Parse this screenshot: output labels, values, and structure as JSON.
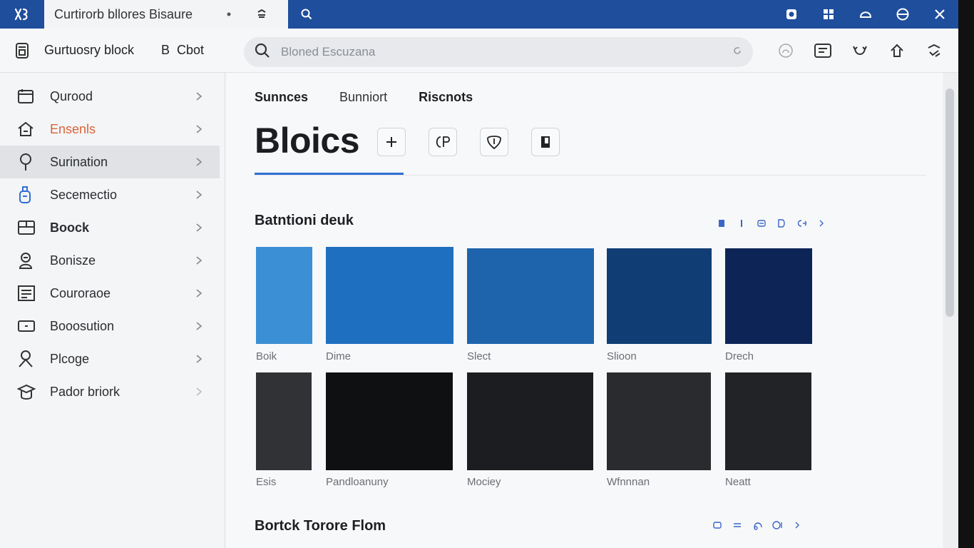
{
  "titlebar": {
    "logo_icon": "app-logo-icon",
    "tab_title": "Curtirorb bllores Bisaure",
    "tab_controls": [
      "dot-icon",
      "restore-icon"
    ],
    "search_icon": "search-icon",
    "window_controls": [
      "record-icon",
      "grid-icon",
      "minimize-icon",
      "globe-icon",
      "close-icon"
    ],
    "accent": "#1f4e9c"
  },
  "toolbar": {
    "app_icon": "printer-icon",
    "app_name": "Gurtuosry block",
    "app_b": "B",
    "app_chat": "Cbot",
    "search_placeholder": "Bloned Escuzana",
    "tools": [
      "help-icon",
      "message-icon",
      "refresh-icon",
      "home-icon",
      "settings-icon"
    ]
  },
  "sidebar": {
    "items": [
      {
        "label": "Qurood",
        "icon": "calendar-icon",
        "active": false,
        "color": "#2a2d31"
      },
      {
        "label": "Ensenls",
        "icon": "house-icon",
        "active": false,
        "color": "#d8643c"
      },
      {
        "label": "Surination",
        "icon": "pin-icon",
        "active": true,
        "color": "#2a2d31"
      },
      {
        "label": "Secemectio",
        "icon": "bottle-icon",
        "active": false,
        "color": "#2a2d31"
      },
      {
        "label": "Boock",
        "icon": "box-icon",
        "active": false,
        "color": "#2a2d31"
      },
      {
        "label": "Bonisze",
        "icon": "person-icon",
        "active": false,
        "color": "#2a2d31"
      },
      {
        "label": "Couroraoe",
        "icon": "document-icon",
        "active": false,
        "color": "#2a2d31"
      },
      {
        "label": "Booosution",
        "icon": "card-icon",
        "active": false,
        "color": "#2a2d31"
      },
      {
        "label": "Plcoge",
        "icon": "user-icon",
        "active": false,
        "color": "#2a2d31"
      },
      {
        "label": "Pador briork",
        "icon": "cap-icon",
        "active": false,
        "color": "#2a2d31"
      }
    ]
  },
  "main": {
    "tabs": [
      {
        "label": "Sunnces",
        "bold": true
      },
      {
        "label": "Bunniort",
        "bold": false
      },
      {
        "label": "Riscnots",
        "bold": true
      }
    ],
    "title": "Bloics",
    "title_actions": [
      "plus-icon",
      "copy-icon",
      "shield-icon",
      "bookmark-icon"
    ],
    "accent": "#2f6fd6",
    "section1": {
      "title": "Batntioni deuk",
      "tools": [
        "doc-icon",
        "bar-icon",
        "layers-icon",
        "doc-icon",
        "link-icon",
        "chevron-right-icon"
      ],
      "swatches": [
        {
          "label": "Boik",
          "color": "#3b8fd4"
        },
        {
          "label": "Dime",
          "color": "#1f6fc1"
        },
        {
          "label": "Slect",
          "color": "#1e64ad"
        },
        {
          "label": "Slioon",
          "color": "#103d74"
        },
        {
          "label": "Drech",
          "color": "#0d2556"
        }
      ]
    },
    "section2": {
      "swatches": [
        {
          "label": "Esis",
          "color": "#303236"
        },
        {
          "label": "Pandloanuny",
          "color": "#0f1012"
        },
        {
          "label": "Mociey",
          "color": "#1b1d20"
        },
        {
          "label": "Wfnnnan",
          "color": "#2a2b2e"
        },
        {
          "label": "Neatt",
          "color": "#222326"
        }
      ]
    },
    "section3": {
      "title": "Bortck Torore Flom",
      "tools": [
        "doc-icon",
        "sliders-icon",
        "refresh-icon",
        "circle-icon",
        "chevron-right-icon"
      ]
    }
  }
}
